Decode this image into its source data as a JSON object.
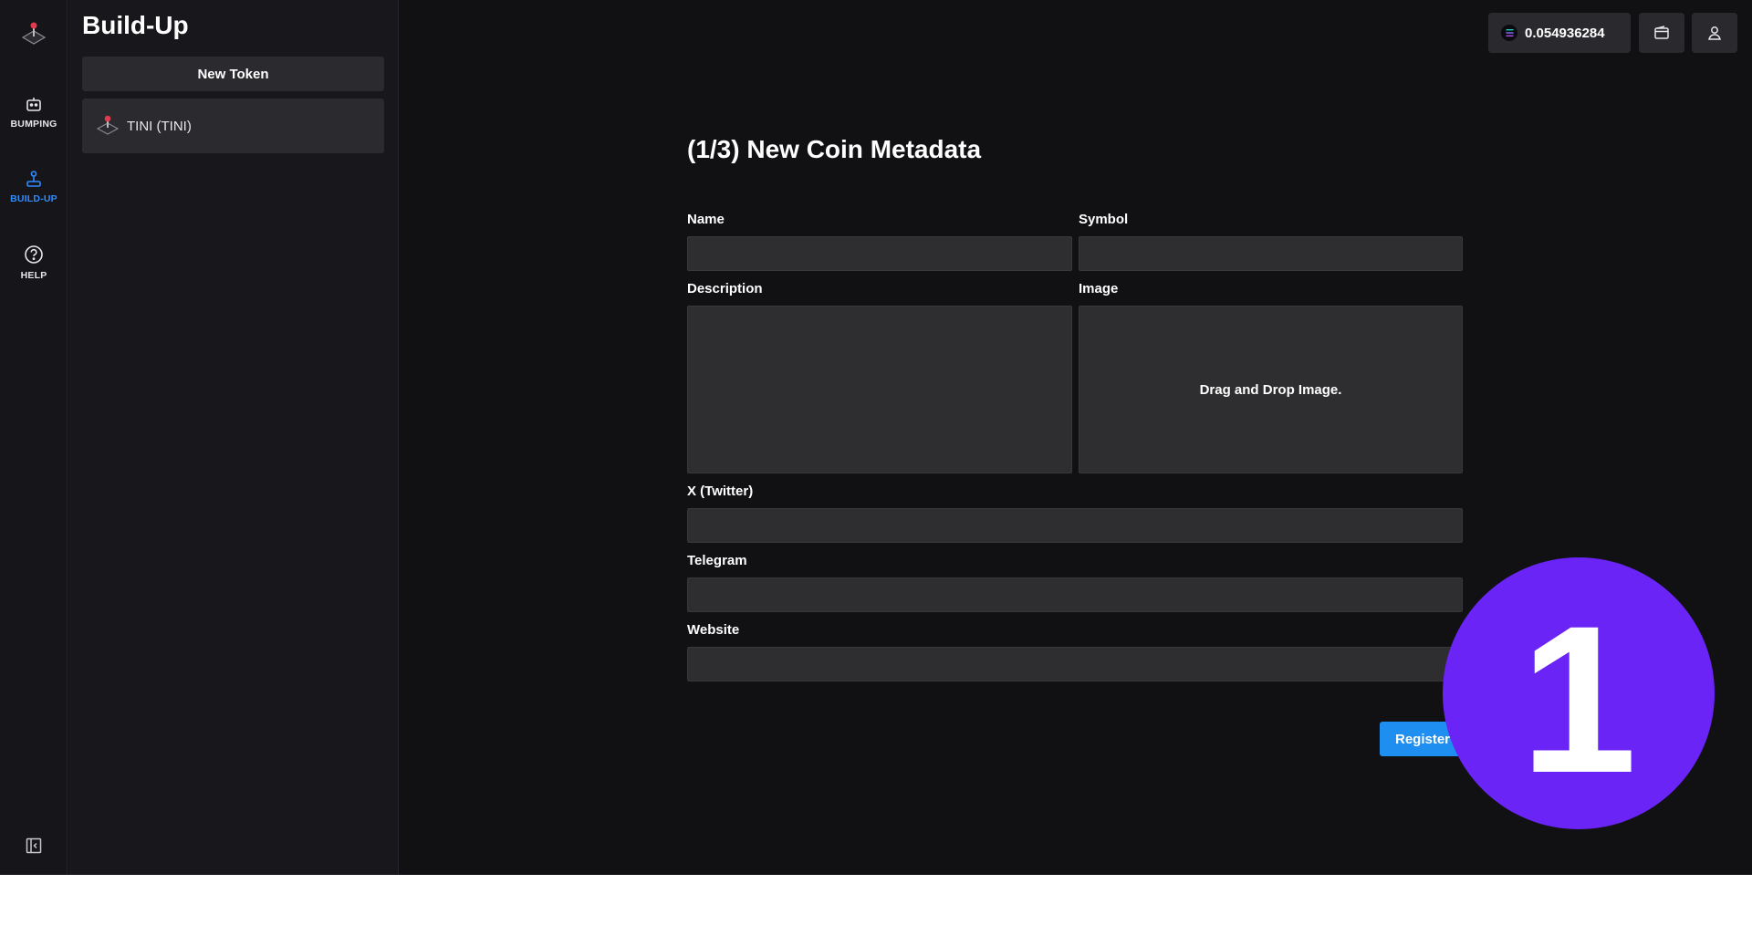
{
  "rail": {
    "items": [
      {
        "label": "BUMPING",
        "icon": "robot-icon"
      },
      {
        "label": "BUILD-UP",
        "icon": "joystick-icon",
        "active": true
      },
      {
        "label": "HELP",
        "icon": "help-circle-icon"
      }
    ],
    "collapse_icon": "sidebar-collapse-icon"
  },
  "panel": {
    "title": "Build-Up",
    "new_token_label": "New Token",
    "tokens": [
      {
        "label": "TINI (TINI)",
        "icon": "joystick-icon"
      }
    ]
  },
  "header": {
    "balance": "0.054936284",
    "balance_icon": "solana-icon",
    "wallet_icon": "wallet-icon",
    "profile_icon": "user-icon"
  },
  "form": {
    "title": "(1/3) New Coin Metadata",
    "name_label": "Name",
    "name_value": "",
    "symbol_label": "Symbol",
    "symbol_value": "",
    "description_label": "Description",
    "description_value": "",
    "image_label": "Image",
    "image_drop_text": "Drag and Drop Image.",
    "twitter_label": "X (Twitter)",
    "twitter_value": "",
    "telegram_label": "Telegram",
    "telegram_value": "",
    "website_label": "Website",
    "website_value": "",
    "register_label": "Register"
  },
  "step_badge": "1",
  "colors": {
    "background": "#111114",
    "accent_blue": "#1e8ef0",
    "active_nav": "#2f8cff",
    "badge_purple": "#6a24f5"
  }
}
